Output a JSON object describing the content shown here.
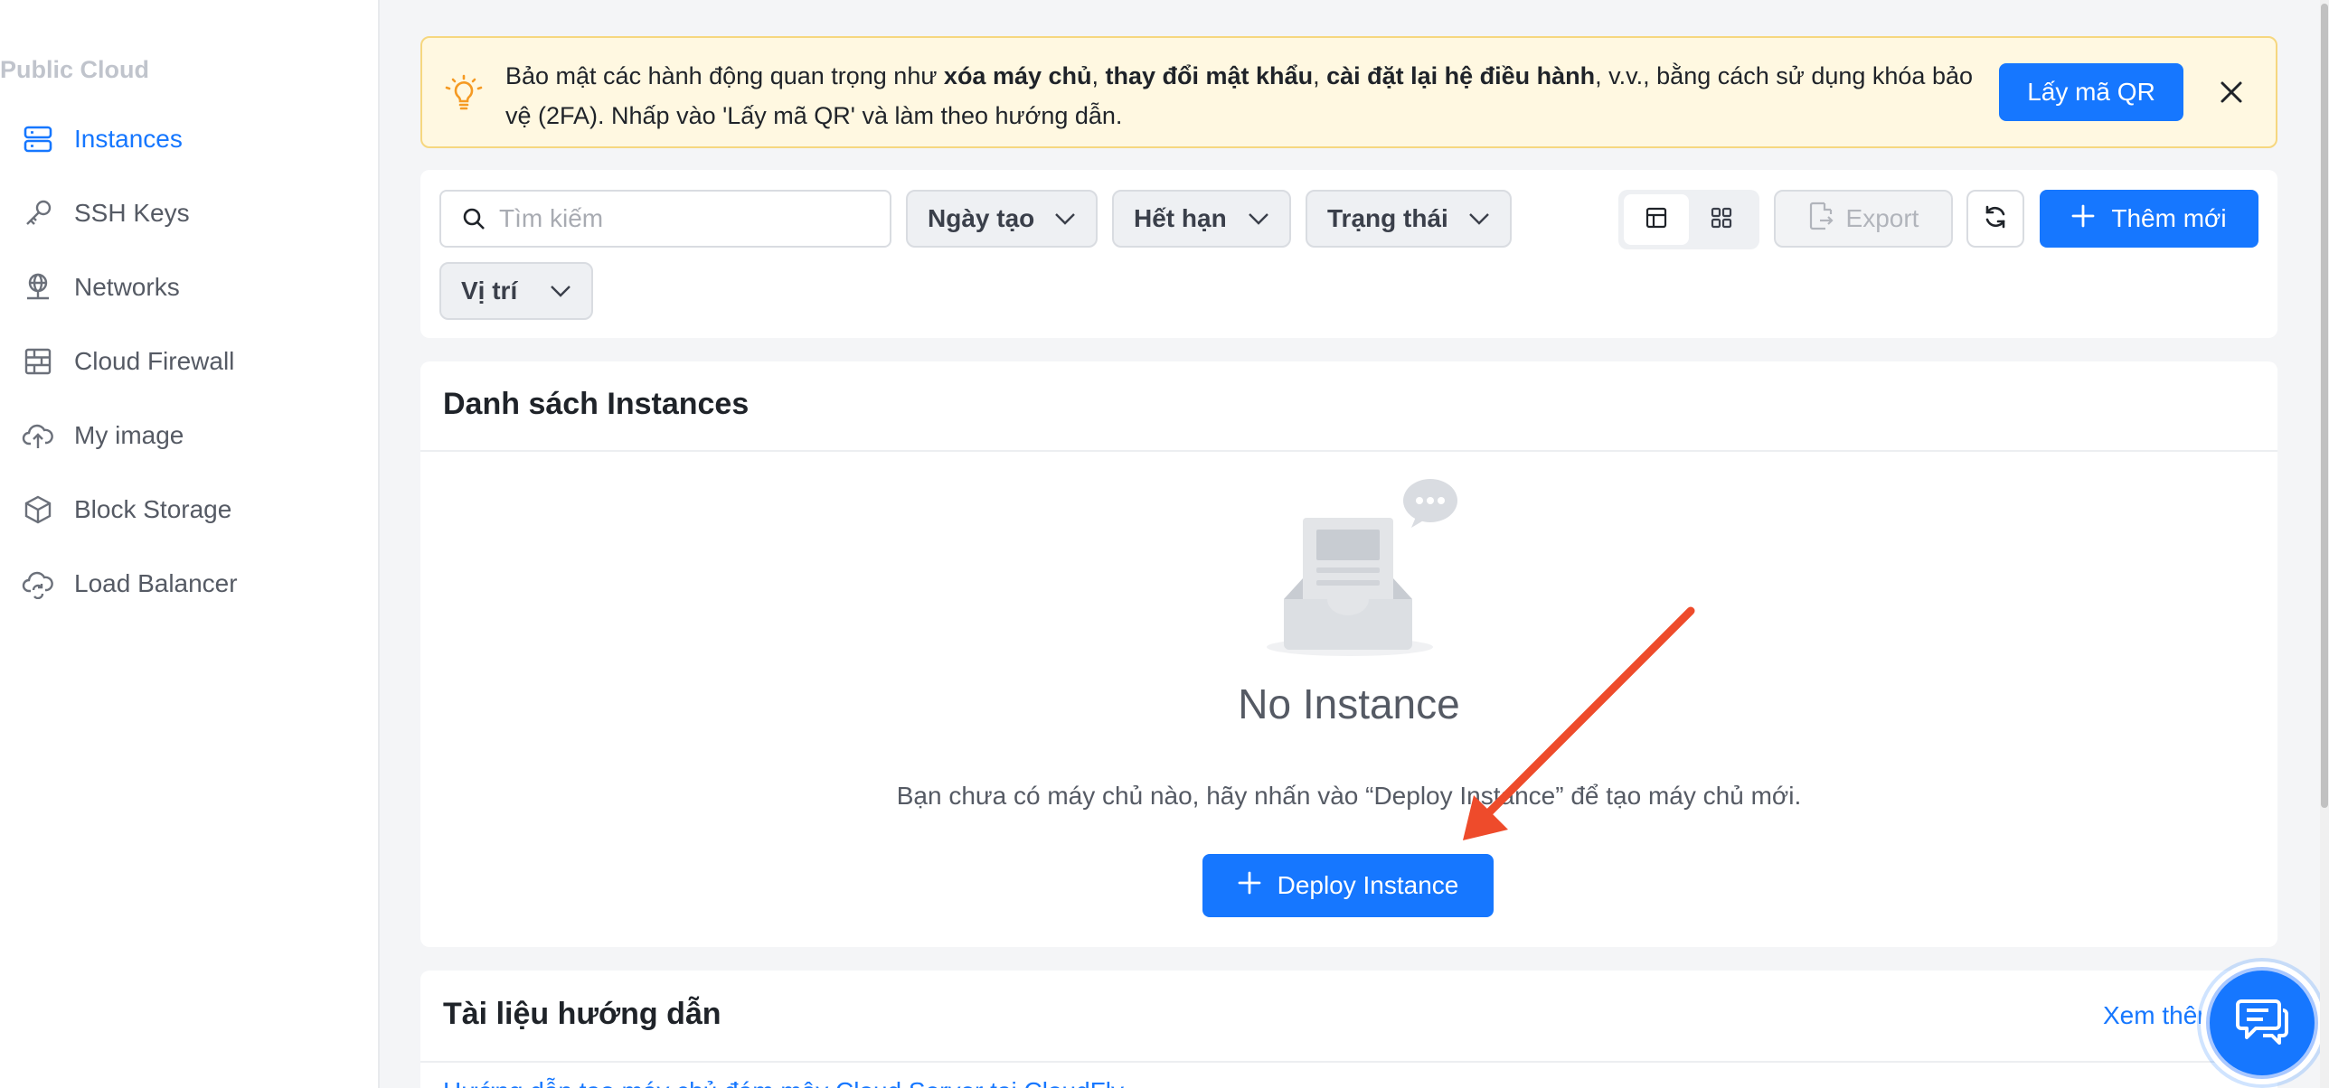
{
  "sidebar": {
    "section_title": "Public Cloud",
    "items": [
      {
        "label": "Instances",
        "icon": "server-icon",
        "active": true
      },
      {
        "label": "SSH Keys",
        "icon": "key-icon"
      },
      {
        "label": "Networks",
        "icon": "network-icon"
      },
      {
        "label": "Cloud Firewall",
        "icon": "firewall-icon"
      },
      {
        "label": "My image",
        "icon": "cloud-upload-icon"
      },
      {
        "label": "Block Storage",
        "icon": "cube-icon"
      },
      {
        "label": "Load Balancer",
        "icon": "cloud-sync-icon"
      }
    ]
  },
  "banner": {
    "text_1": "Bảo mật các hành động quan trọng như ",
    "bold_1": "xóa máy chủ",
    "sep_1": ", ",
    "bold_2": "thay đổi mật khẩu",
    "sep_2": ", ",
    "bold_3": "cài đặt lại hệ điều hành",
    "text_2": ", v.v., bằng cách sử dụng khóa bảo vệ (2FA). Nhấp vào 'Lấy mã QR' và làm theo hướng dẫn.",
    "qr_button": "Lấy mã QR"
  },
  "filters": {
    "search_placeholder": "Tìm kiếm",
    "created": "Ngày tạo",
    "expiry": "Hết hạn",
    "status": "Trạng thái",
    "location": "Vị trí",
    "export": "Export",
    "add_new": "Thêm mới"
  },
  "instances": {
    "title": "Danh sách Instances",
    "empty_title": "No Instance",
    "empty_desc": "Bạn chưa có máy chủ nào, hãy nhấn vào “Deploy Instance” để tạo máy chủ mới.",
    "deploy_button": "Deploy Instance"
  },
  "docs": {
    "title": "Tài liệu hướng dẫn",
    "see_more": "Xem thêm",
    "first_link": "Hướng dẫn tạo máy chủ đám mây Cloud Server tại CloudFly"
  },
  "colors": {
    "primary": "#1677ff",
    "banner_bg": "#fff8e1",
    "banner_border": "#f6d77f",
    "annotation_arrow": "#ee4b2b"
  }
}
